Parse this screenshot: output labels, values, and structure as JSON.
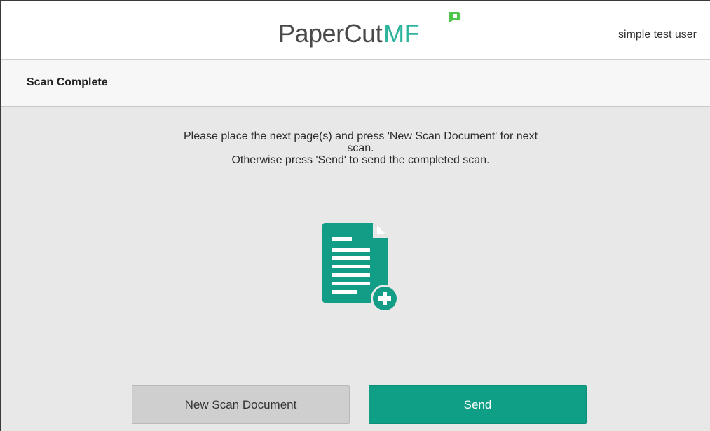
{
  "header": {
    "logo_text_main": "PaperCut",
    "logo_text_accent": "MF",
    "user_name": "simple test user"
  },
  "page": {
    "title": "Scan Complete"
  },
  "message": {
    "line1": "Please place the next page(s) and press 'New Scan Document' for next",
    "line2": "scan.",
    "line3": "Otherwise press 'Send' to send the completed scan."
  },
  "icons": {
    "document": "document-add-icon",
    "logo_mark": "papercut-leaf-icon"
  },
  "buttons": {
    "new_scan_label": "New Scan Document",
    "send_label": "Send"
  },
  "colors": {
    "accent": "#0e9f86",
    "brand_green": "#2cb49c",
    "secondary_button": "#cfcfcf",
    "background": "#e8e8e8"
  }
}
